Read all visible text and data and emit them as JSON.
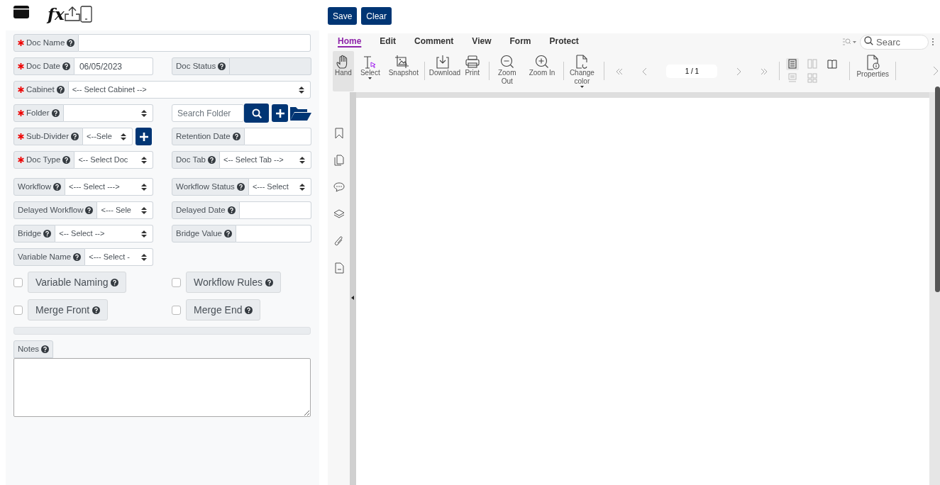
{
  "top_icons": {
    "formula": "fx"
  },
  "form": {
    "sections": [
      {
        "rows": [
          {
            "fields": [
              {
                "label": "Doc Name",
                "required": true,
                "kind": "text",
                "full_width": true
              }
            ]
          },
          {
            "fields": [
              {
                "label": "Doc Date",
                "required": true,
                "kind": "text",
                "value": "06/05/2023"
              },
              {
                "label": "Doc Status",
                "required": false,
                "kind": "readonly"
              }
            ]
          },
          {
            "fields": [
              {
                "label": "Cabinet",
                "required": true,
                "kind": "select",
                "value": "<-- Select Cabinet -->",
                "full_width": true
              }
            ]
          },
          {
            "fields": [
              {
                "label": "Folder",
                "required": true,
                "kind": "select"
              },
              {
                "kind": "search",
                "placeholder": "Search Folder"
              }
            ]
          },
          {
            "fields": [
              {
                "label": "Sub-Divider",
                "required": true,
                "kind": "select_add",
                "value": "<--Sele"
              },
              {
                "label": "Retention Date",
                "required": false,
                "kind": "text"
              }
            ]
          },
          {
            "fields": [
              {
                "label": "Doc Type",
                "required": true,
                "kind": "select",
                "value": "<-- Select Doc"
              },
              {
                "label": "Doc Tab",
                "required": false,
                "kind": "select",
                "value": "<-- Select Tab -->"
              }
            ]
          }
        ]
      },
      {
        "rows": [
          {
            "fields": [
              {
                "label": "Workflow",
                "required": false,
                "kind": "select",
                "value": "<--- Select --->"
              },
              {
                "label": "Workflow Status",
                "required": false,
                "kind": "select",
                "value": "<--- Select"
              }
            ]
          },
          {
            "fields": [
              {
                "label": "Delayed Workflow",
                "required": false,
                "kind": "select",
                "value": "<--- Sele"
              },
              {
                "label": "Delayed Date",
                "required": false,
                "kind": "text"
              }
            ]
          },
          {
            "fields": [
              {
                "label": "Bridge",
                "required": false,
                "kind": "select",
                "value": "<-- Select -->"
              },
              {
                "label": "Bridge Value",
                "required": false,
                "kind": "text"
              }
            ]
          },
          {
            "fields": [
              {
                "label": "Variable Name",
                "required": false,
                "kind": "select",
                "value": "<--- Select -"
              }
            ]
          },
          {
            "fields": [
              {
                "label": "Variable Naming",
                "kind": "checkbox",
                "checked": false
              },
              {
                "label": "Workflow Rules",
                "kind": "checkbox",
                "checked": false
              }
            ]
          },
          {
            "fields": [
              {
                "label": "Merge Front",
                "kind": "checkbox",
                "checked": false
              },
              {
                "label": "Merge End",
                "kind": "checkbox",
                "checked": false
              }
            ]
          }
        ]
      }
    ],
    "notes": {
      "label": "Notes"
    }
  },
  "actions": [
    {
      "label": "Save"
    },
    {
      "label": "Clear"
    }
  ],
  "viewer": {
    "tabs": [
      {
        "label": "Home",
        "selected": true
      },
      {
        "label": "Edit",
        "selected": false
      },
      {
        "label": "Comment",
        "selected": false
      },
      {
        "label": "View",
        "selected": false
      },
      {
        "label": "Form",
        "selected": false
      },
      {
        "label": "Protect",
        "selected": false
      }
    ],
    "search": {
      "placeholder": "Searc"
    },
    "tools": [
      {
        "label": "Hand",
        "kind": "hand",
        "selected": true,
        "dropdown": false
      },
      {
        "label": "Select",
        "kind": "select",
        "selected": false,
        "dropdown": true
      },
      {
        "label": "Snapshot",
        "kind": "snapshot",
        "selected": false,
        "dropdown": false
      },
      {
        "label": "Download",
        "kind": "download",
        "selected": false,
        "dropdown": false
      },
      {
        "label": "Print",
        "kind": "print",
        "selected": false,
        "dropdown": false
      },
      {
        "label": "Zoom Out",
        "kind": "zoomout",
        "selected": false,
        "dropdown": false
      },
      {
        "label": "Zoom In",
        "kind": "zoomin",
        "selected": false,
        "dropdown": false
      },
      {
        "label": "Change color",
        "kind": "color",
        "selected": false,
        "dropdown": true
      }
    ],
    "page": {
      "value": "1 / 1"
    },
    "view_modes": [
      {
        "kind": "single",
        "selected": true
      },
      {
        "kind": "double",
        "selected": false
      },
      {
        "kind": "book",
        "selected": false
      },
      {
        "kind": "scroll",
        "selected": false
      },
      {
        "kind": "double_scroll",
        "selected": false
      }
    ],
    "properties": {
      "label": "Properties"
    }
  }
}
